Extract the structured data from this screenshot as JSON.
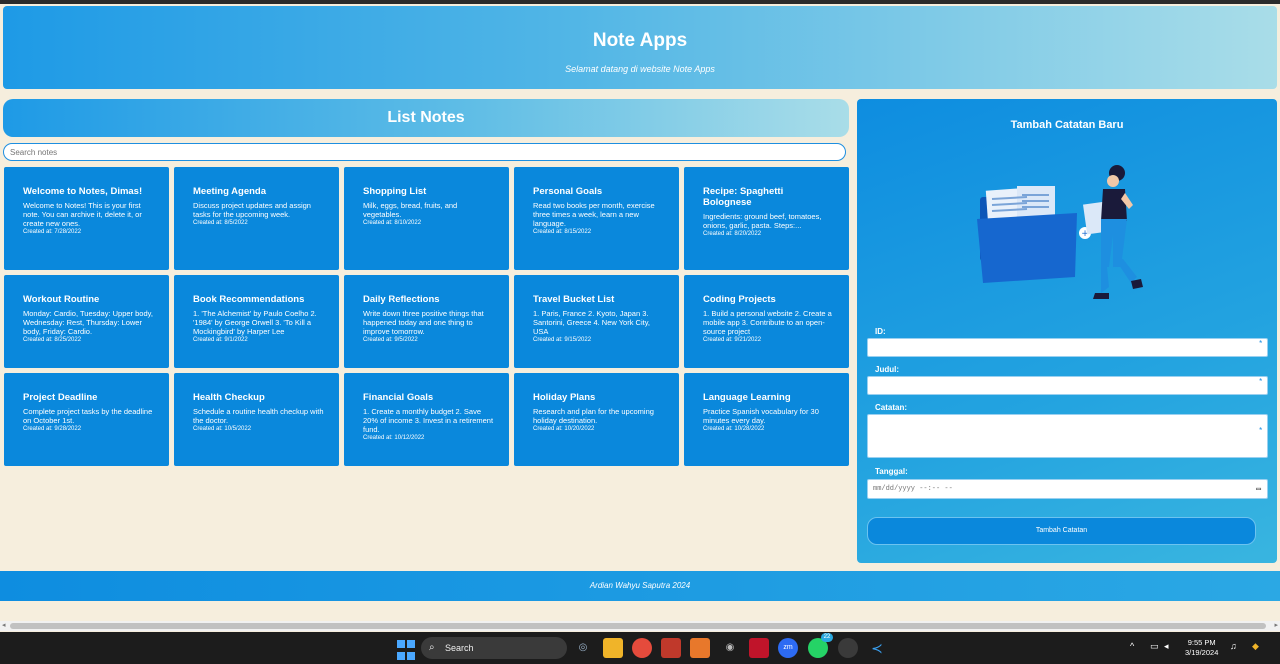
{
  "header": {
    "title": "Note Apps",
    "subtitle": "Selamat datang di website Note Apps"
  },
  "list": {
    "title": "List Notes",
    "search_placeholder": "Search notes",
    "notes": [
      {
        "title": "Welcome to Notes, Dimas!",
        "body": "Welcome to Notes! This is your first note. You can archive it, delete it, or create new ones.",
        "date": "Created at: 7/28/2022"
      },
      {
        "title": "Meeting Agenda",
        "body": "Discuss project updates and assign tasks for the upcoming week.",
        "date": "Created at: 8/5/2022"
      },
      {
        "title": "Shopping List",
        "body": "Milk, eggs, bread, fruits, and vegetables.",
        "date": "Created at: 8/10/2022"
      },
      {
        "title": "Personal Goals",
        "body": "Read two books per month, exercise three times a week, learn a new language.",
        "date": "Created at: 8/15/2022"
      },
      {
        "title": "Recipe: Spaghetti Bolognese",
        "body": "Ingredients: ground beef, tomatoes, onions, garlic, pasta. Steps:...",
        "date": "Created at: 8/20/2022"
      },
      {
        "title": "Workout Routine",
        "body": "Monday: Cardio, Tuesday: Upper body, Wednesday: Rest, Thursday: Lower body, Friday: Cardio.",
        "date": "Created at: 8/25/2022"
      },
      {
        "title": "Book Recommendations",
        "body": "1. 'The Alchemist' by Paulo Coelho 2. '1984' by George Orwell 3. 'To Kill a Mockingbird' by Harper Lee",
        "date": "Created at: 9/1/2022"
      },
      {
        "title": "Daily Reflections",
        "body": "Write down three positive things that happened today and one thing to improve tomorrow.",
        "date": "Created at: 9/5/2022"
      },
      {
        "title": "Travel Bucket List",
        "body": "1. Paris, France 2. Kyoto, Japan 3. Santorini, Greece 4. New York City, USA",
        "date": "Created at: 9/15/2022"
      },
      {
        "title": "Coding Projects",
        "body": "1. Build a personal website 2. Create a mobile app 3. Contribute to an open-source project",
        "date": "Created at: 9/21/2022"
      },
      {
        "title": "Project Deadline",
        "body": "Complete project tasks by the deadline on October 1st.",
        "date": "Created at: 9/28/2022"
      },
      {
        "title": "Health Checkup",
        "body": "Schedule a routine health checkup with the doctor.",
        "date": "Created at: 10/5/2022"
      },
      {
        "title": "Financial Goals",
        "body": "1. Create a monthly budget 2. Save 20% of income 3. Invest in a retirement fund.",
        "date": "Created at: 10/12/2022"
      },
      {
        "title": "Holiday Plans",
        "body": "Research and plan for the upcoming holiday destination.",
        "date": "Created at: 10/20/2022"
      },
      {
        "title": "Language Learning",
        "body": "Practice Spanish vocabulary for 30 minutes every day.",
        "date": "Created at: 10/28/2022"
      }
    ]
  },
  "form": {
    "title": "Tambah Catatan Baru",
    "id_label": "ID:",
    "judul_label": "Judul:",
    "catatan_label": "Catatan:",
    "tanggal_label": "Tanggal:",
    "date_placeholder": "mm/dd/yyyy --:-- --",
    "required_mark": "*",
    "submit_label": "Tambah Catatan"
  },
  "footer": {
    "text": "Ardian Wahyu Saputra 2024"
  },
  "taskbar": {
    "search_label": "Search",
    "time": "9:55 PM",
    "date": "3/19/2024",
    "whatsapp_badge": "22"
  },
  "colors": {
    "primary": "#0a88dc",
    "accent": "#1e9ae6",
    "background": "#f6eedd"
  }
}
